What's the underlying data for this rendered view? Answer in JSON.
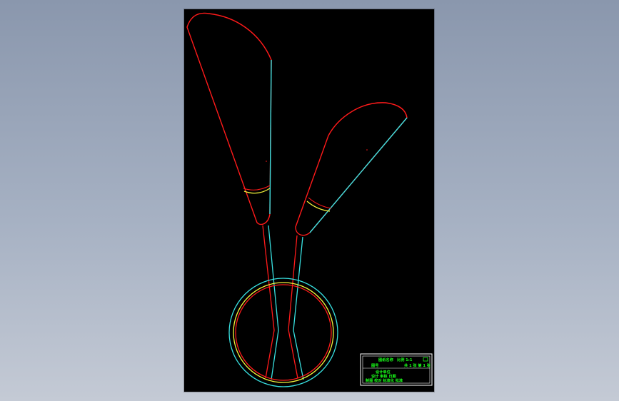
{
  "colors": {
    "background_top": "#8a97ad",
    "background_bottom": "#c4cad5",
    "sheet": "#000000",
    "red_outline": "#ff1a1a",
    "cyan_outline": "#38e0e0",
    "yellow_outline": "#f2f23a",
    "title_block_border": "#ffffff",
    "title_block_text": "#19ff19"
  },
  "title_block": {
    "row1_left": "图纸名称",
    "row1_mid": "比例 1:1",
    "row1_right": "",
    "row2_left": "图号",
    "row2_right": "共 1 张 第 1 张",
    "row3": "设计单位",
    "row4": "设计 审核 日期",
    "row5": "制图 校对 标准化 批准"
  }
}
